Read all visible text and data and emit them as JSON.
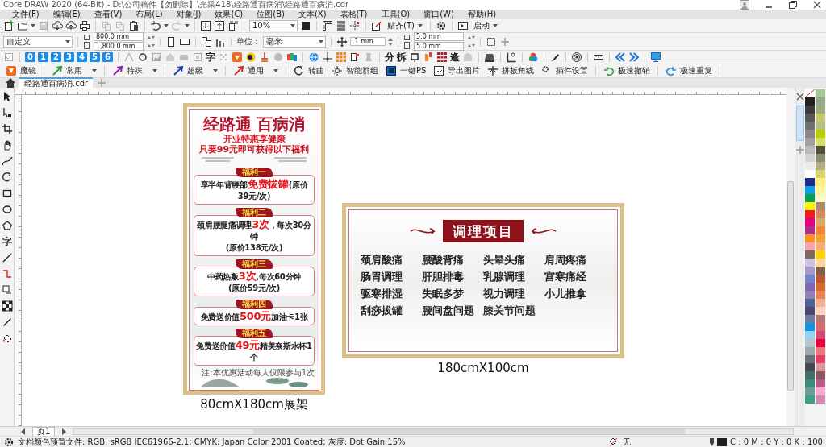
{
  "window": {
    "title": "CorelDRAW 2020 (64-Bit) - D:\\公司稿件【勿删除】\\光采418\\经路通百病消\\经路通百病消.cdr"
  },
  "menu": [
    "文件(F)",
    "编辑(E)",
    "查看(V)",
    "布局(L)",
    "对象(J)",
    "效果(C)",
    "位图(B)",
    "文本(X)",
    "表格(T)",
    "工具(O)",
    "窗口(W)",
    "帮助(H)"
  ],
  "standard_toolbar": {
    "zoom": "10%",
    "snap": "贴齐(T)",
    "launch": "启动"
  },
  "property_bar": {
    "preset": "自定义",
    "width": "800.0 mm",
    "height": "1,800.0 mm",
    "units_label": "单位：",
    "units": "毫米",
    "nudge": ".1 mm",
    "duplicate_x": "5.0 mm",
    "duplicate_y": "5.0 mm"
  },
  "plugin_toolbar": {
    "numbers": [
      "0",
      "1",
      "2",
      "3",
      "4",
      "5",
      "6"
    ],
    "glyph_buttons": [
      "字",
      "分",
      "拆",
      "逄"
    ]
  },
  "plugin_menu": [
    {
      "label": "魔镜",
      "dropdown": false
    },
    {
      "label": "常用",
      "dropdown": true
    },
    {
      "label": "特殊",
      "dropdown": true
    },
    {
      "label": "超级",
      "dropdown": true
    },
    {
      "label": "通用",
      "dropdown": true
    },
    {
      "label": "转曲",
      "dropdown": false
    },
    {
      "label": "智能群组",
      "dropdown": false
    },
    {
      "label": "一键PS",
      "dropdown": false
    },
    {
      "label": "导出图片",
      "dropdown": false
    },
    {
      "label": "拼板角线",
      "dropdown": false
    },
    {
      "label": "插件设置",
      "dropdown": false
    },
    {
      "label": "极速撤销",
      "dropdown": false
    },
    {
      "label": "极速重复",
      "dropdown": false
    }
  ],
  "document_tab": "经路通百病消.cdr",
  "toolbox_text_tool": "字",
  "banner": {
    "title": "经路通 百病消",
    "subtitles": [
      "开业特惠享健康",
      "只要99元即可获得以下福利"
    ],
    "benefits": [
      {
        "tag": "福利一",
        "lines": [
          "享半年背腰部**免费拔罐**(原价39元/次)"
        ]
      },
      {
        "tag": "福利二",
        "lines": [
          "颈肩腰腿痛调理**3次**，每次30分钟",
          "(原价138元/次)"
        ]
      },
      {
        "tag": "福利三",
        "lines": [
          "中药热敷**3次**,每次60分钟",
          "(原价59元/次)"
        ]
      },
      {
        "tag": "福利四",
        "lines": [
          "免费送价值**500元**加油卡1张"
        ]
      },
      {
        "tag": "福利五",
        "lines": [
          "免费送价值**49元**精美奈斯水杯1个"
        ]
      }
    ],
    "footnote": "注:本优惠活动每人仅限参与1次",
    "caption": "80cmX180cm展架"
  },
  "board": {
    "title": "调理项目",
    "items": [
      "颈肩酸痛",
      "腰酸背痛",
      "头晕头痛",
      "肩周疼痛",
      "肠胃调理",
      "肝胆排毒",
      "乳腺调理",
      "宫寒痛经",
      "驱寒排湿",
      "失眠多梦",
      "视力调理",
      "小儿推拿",
      "刮痧拔罐",
      "腰间盘问题",
      "膝关节问题"
    ],
    "caption": "180cmX100cm"
  },
  "page_tab": "页1",
  "status_bar": {
    "color_profile": "文档颜色预置文件: RGB: sRGB IEC61966-2.1; CMYK: Japan Color 2001 Coated; 灰度: Dot Gain 15%",
    "fill": "无",
    "outline": "C : 0 M : 0 Y : 0 K : 100"
  },
  "palette": {
    "columns": [
      [
        {
          "kind": "none"
        },
        {
          "kind": "color",
          "color": "#231f20"
        },
        {
          "kind": "color",
          "color": "#3d3a3b"
        },
        {
          "kind": "color",
          "color": "#595657"
        },
        {
          "kind": "color",
          "color": "#717071"
        },
        {
          "kind": "color",
          "color": "#898788"
        },
        {
          "kind": "color",
          "color": "#a3a1a2"
        },
        {
          "kind": "color",
          "color": "#bcbbbb"
        },
        {
          "kind": "color",
          "color": "#d5d4d4"
        },
        {
          "kind": "color",
          "color": "#ececec"
        },
        {
          "kind": "color",
          "color": "#ffffff"
        },
        {
          "kind": "color",
          "color": "#1b2b8a"
        },
        {
          "kind": "color",
          "color": "#0d9ee8"
        },
        {
          "kind": "color",
          "color": "#0aa04b"
        },
        {
          "kind": "color",
          "color": "#fff200"
        },
        {
          "kind": "color",
          "color": "#ed1c24"
        },
        {
          "kind": "color",
          "color": "#e6007e"
        },
        {
          "kind": "color",
          "color": "#a9308c"
        },
        {
          "kind": "color",
          "color": "#f7941d"
        },
        {
          "kind": "color",
          "color": "#f5a6a9"
        },
        {
          "kind": "color",
          "color": "#7d675e"
        },
        {
          "kind": "color",
          "color": "#c9c4e1"
        },
        {
          "kind": "color",
          "color": "#a897c9"
        },
        {
          "kind": "color",
          "color": "#6f86c8"
        },
        {
          "kind": "color",
          "color": "#7f66b0"
        },
        {
          "kind": "color",
          "color": "#9181b7"
        },
        {
          "kind": "color",
          "color": "#4b6394"
        },
        {
          "kind": "color",
          "color": "#4a4a6e"
        },
        {
          "kind": "color",
          "color": "#6a7fa0"
        },
        {
          "kind": "color",
          "color": "#0d95e0"
        },
        {
          "kind": "color",
          "color": "#98d3f5"
        },
        {
          "kind": "color",
          "color": "#b7c4cc"
        },
        {
          "kind": "color",
          "color": "#a0a7ad"
        },
        {
          "kind": "color",
          "color": "#6d7276"
        },
        {
          "kind": "color",
          "color": "#434b50"
        },
        {
          "kind": "color",
          "color": "#3f6f66"
        },
        {
          "kind": "color",
          "color": "#3b8b78"
        },
        {
          "kind": "color",
          "color": "#6b9b94"
        },
        {
          "kind": "color",
          "color": "#39a285"
        }
      ],
      [
        {
          "kind": "color",
          "color": "#a5c895"
        },
        {
          "kind": "color",
          "color": "#99a890"
        },
        {
          "kind": "color",
          "color": "#9cae80"
        },
        {
          "kind": "color",
          "color": "#c4c96d"
        },
        {
          "kind": "color",
          "color": "#b5c08a"
        },
        {
          "kind": "color",
          "color": "#b8d000"
        },
        {
          "kind": "color",
          "color": "#d8df65"
        },
        {
          "kind": "color",
          "color": "#534f3c"
        },
        {
          "kind": "color",
          "color": "#8a8e70"
        },
        {
          "kind": "color",
          "color": "#b2b083"
        },
        {
          "kind": "color",
          "color": "#d9d46a"
        },
        {
          "kind": "color",
          "color": "#fff07e"
        },
        {
          "kind": "color",
          "color": "#fff5a0"
        },
        {
          "kind": "color",
          "color": "#fff8c8"
        },
        {
          "kind": "color",
          "color": "#a8896b"
        },
        {
          "kind": "color",
          "color": "#d08a5c"
        },
        {
          "kind": "color",
          "color": "#d9a966"
        },
        {
          "kind": "color",
          "color": "#f08838"
        },
        {
          "kind": "color",
          "color": "#f3a238"
        },
        {
          "kind": "color",
          "color": "#f5ad7b"
        },
        {
          "kind": "color",
          "color": "#ffd100"
        },
        {
          "kind": "color",
          "color": "#fcd59b"
        },
        {
          "kind": "color",
          "color": "#7b6148"
        },
        {
          "kind": "color",
          "color": "#b8553a"
        },
        {
          "kind": "color",
          "color": "#d66a2a"
        },
        {
          "kind": "color",
          "color": "#ee8358"
        },
        {
          "kind": "color",
          "color": "#f6b093"
        },
        {
          "kind": "color",
          "color": "#fdd3c0"
        },
        {
          "kind": "color",
          "color": "#b37777"
        },
        {
          "kind": "color",
          "color": "#d46a6f"
        },
        {
          "kind": "color",
          "color": "#d24a73"
        },
        {
          "kind": "color",
          "color": "#e8003d"
        },
        {
          "kind": "color",
          "color": "#ef767b"
        },
        {
          "kind": "color",
          "color": "#e43f60"
        },
        {
          "kind": "color",
          "color": "#d89aa0"
        },
        {
          "kind": "color",
          "color": "#8d5661"
        },
        {
          "kind": "color",
          "color": "#b75c84"
        },
        {
          "kind": "color",
          "color": "#f5aacd"
        },
        {
          "kind": "color",
          "color": "#d289ab"
        }
      ]
    ]
  }
}
